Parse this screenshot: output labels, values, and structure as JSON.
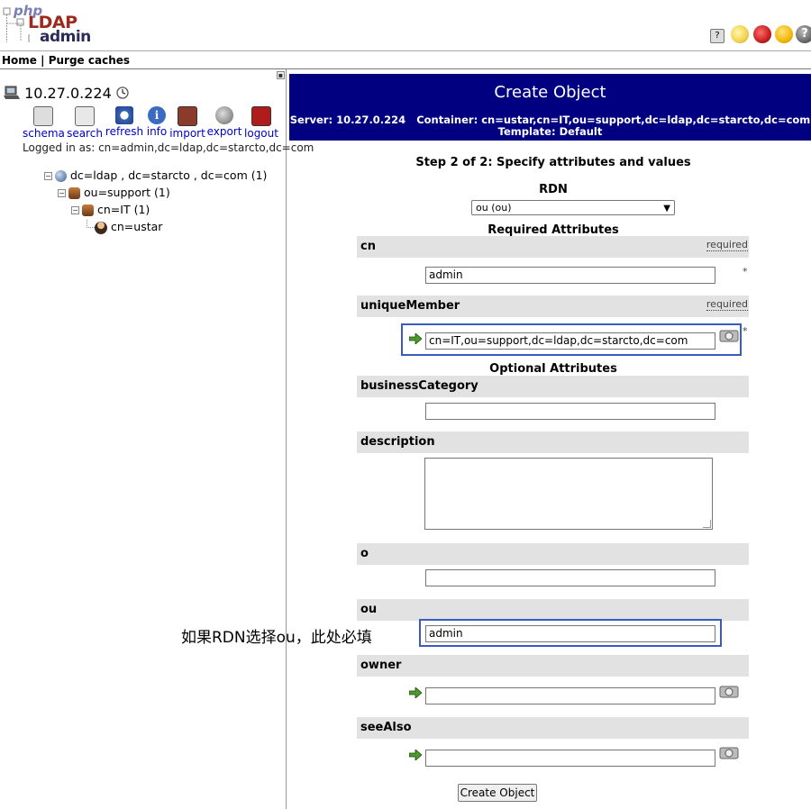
{
  "header": {
    "logo": {
      "php": "php",
      "ldap": "LDAP",
      "admin": "admin"
    },
    "top_icons": [
      {
        "icon": "help-icon",
        "color": "#c9c9c9"
      },
      {
        "icon": "idea-bulb-icon",
        "color": "#f2d24a"
      },
      {
        "icon": "bug-icon",
        "color": "#c62020"
      },
      {
        "icon": "smiley-icon",
        "color": "#f0b400"
      },
      {
        "icon": "question-icon",
        "color": "#666666"
      }
    ],
    "menu": {
      "home": "Home",
      "separator": "|",
      "purge": "Purge caches"
    }
  },
  "sidebar": {
    "server": "10.27.0.224",
    "toolbar": [
      {
        "label": "schema",
        "icon": "schema-icon"
      },
      {
        "label": "search",
        "icon": "search-icon"
      },
      {
        "label": "refresh",
        "icon": "refresh-icon"
      },
      {
        "label": "info",
        "icon": "info-icon"
      },
      {
        "label": "import",
        "icon": "import-icon"
      },
      {
        "label": "export",
        "icon": "export-icon"
      },
      {
        "label": "logout",
        "icon": "logout-icon"
      }
    ],
    "logged_in": "Logged in as: cn=admin,dc=ldap,dc=starcto,dc=com",
    "tree": [
      {
        "label": "dc=ldap , dc=starcto , dc=com (1)",
        "icon": "globe-icon",
        "expander": "−"
      },
      {
        "label": "ou=support (1)",
        "icon": "group-icon",
        "expander": "−"
      },
      {
        "label": "cn=IT (1)",
        "icon": "group-icon",
        "expander": "−"
      },
      {
        "label": "cn=ustar",
        "icon": "user-icon",
        "expander": ""
      }
    ]
  },
  "main": {
    "title": "Create Object",
    "server_label": "Server:",
    "server_value": "10.27.0.224",
    "container_label": "Container:",
    "container_value": "cn=ustar,cn=IT,ou=support,dc=ldap,dc=starcto,dc=com",
    "template_label": "Template:",
    "template_value": "Default",
    "step": "Step 2 of 2: Specify attributes and values",
    "rdn_label": "RDN",
    "rdn_selected": "ou (ou)",
    "required_heading": "Required Attributes",
    "optional_heading": "Optional Attributes",
    "required_tag": "required",
    "star": "*",
    "attributes": {
      "cn": {
        "name": "cn",
        "value": "admin"
      },
      "uniqueMember": {
        "name": "uniqueMember",
        "value": "cn=IT,ou=support,dc=ldap,dc=starcto,dc=com"
      },
      "businessCategory": {
        "name": "businessCategory",
        "value": ""
      },
      "description": {
        "name": "description",
        "value": ""
      },
      "o": {
        "name": "o",
        "value": ""
      },
      "ou": {
        "name": "ou",
        "value": "admin"
      },
      "owner": {
        "name": "owner",
        "value": ""
      },
      "seeAlso": {
        "name": "seeAlso",
        "value": ""
      }
    },
    "annotation": "如果RDN选择ou，此处必填",
    "create_button": "Create Object"
  },
  "colors": {
    "title_bar": "#010080",
    "attr_bar": "#e2e2e2",
    "highlight": "#3a5bbf",
    "link": "#0000c8"
  }
}
